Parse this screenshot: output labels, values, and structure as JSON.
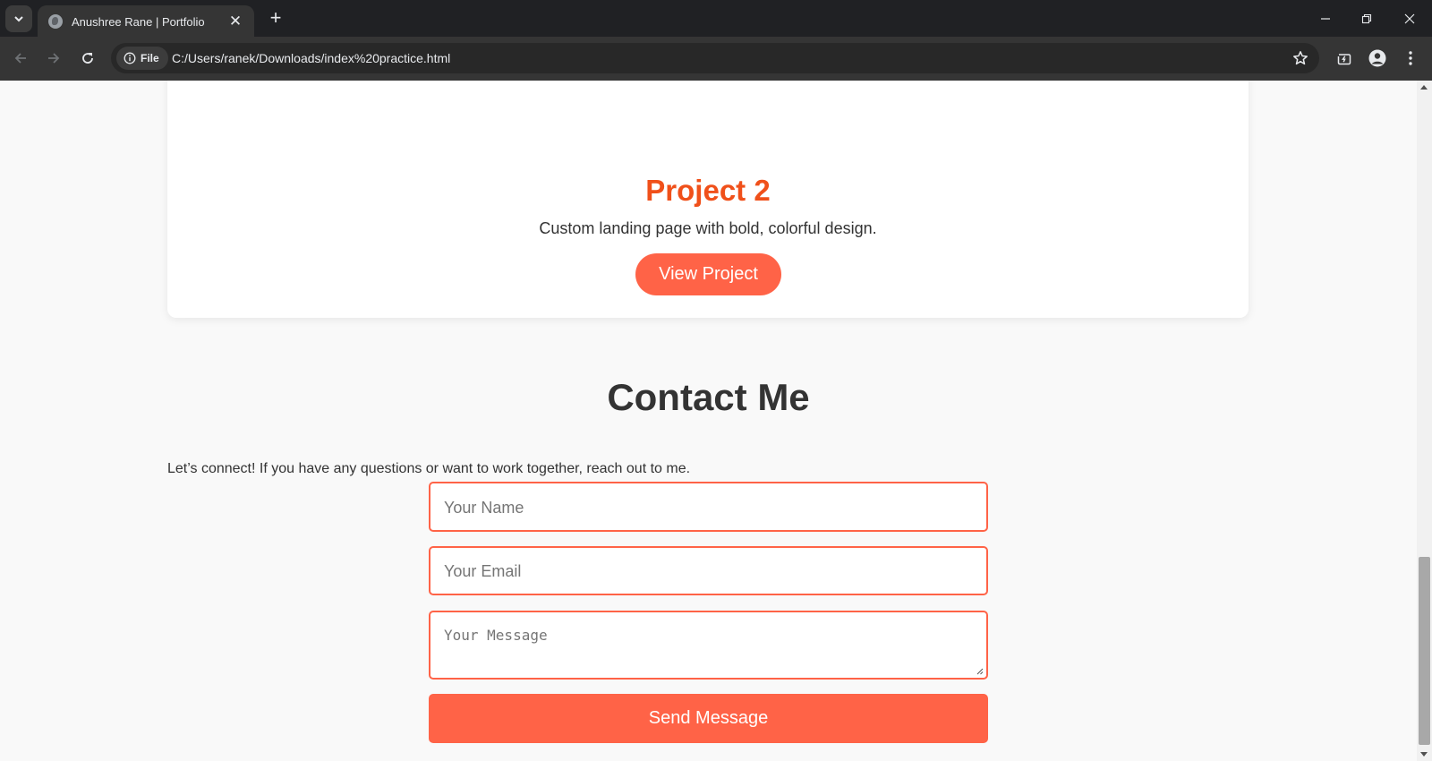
{
  "browser": {
    "tab_title": "Anushree Rane | Portfolio",
    "tab_close": "✕",
    "new_tab": "+",
    "site_chip": "File",
    "url": "C:/Users/ranek/Downloads/index%20practice.html"
  },
  "page": {
    "project": {
      "title": "Project 2",
      "description": "Custom landing page with bold, colorful design.",
      "button_label": "View Project"
    },
    "contact": {
      "title": "Contact Me",
      "intro": "Let’s connect! If you have any questions or want to work together, reach out to me.",
      "name_placeholder": "Your Name",
      "email_placeholder": "Your Email",
      "message_placeholder": "Your Message",
      "submit_label": "Send Message"
    }
  },
  "colors": {
    "accent": "#ff6347",
    "project_title": "#f0501a",
    "page_background": "#f9f9f9",
    "chrome_dark": "#202124"
  }
}
